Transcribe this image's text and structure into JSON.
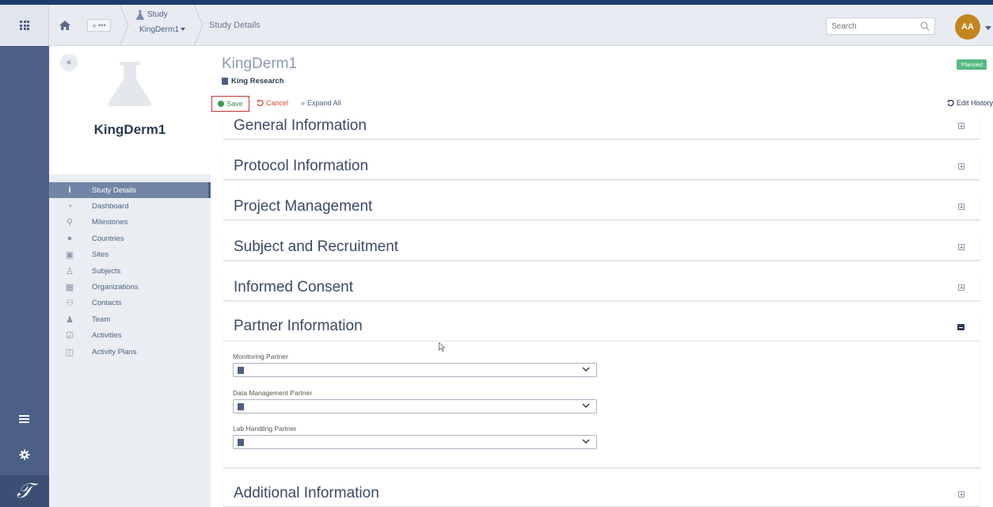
{
  "header": {
    "back_label": "« •••",
    "study_label": "Study",
    "study_value": "KingDerm1",
    "current_page": "Study Details",
    "search_placeholder": "Search",
    "avatar_initials": "AA"
  },
  "study_panel": {
    "collapse_label": "«",
    "study_name": "KingDerm1"
  },
  "nav": {
    "items": [
      {
        "label": "Study Details",
        "icon": "info-icon",
        "active": true
      },
      {
        "label": "Dashboard",
        "icon": "dashboard-icon"
      },
      {
        "label": "Milestones",
        "icon": "map-pin-icon"
      },
      {
        "label": "Countries",
        "icon": "globe-icon"
      },
      {
        "label": "Sites",
        "icon": "hospital-icon"
      },
      {
        "label": "Subjects",
        "icon": "person-icon"
      },
      {
        "label": "Organizations",
        "icon": "building-icon"
      },
      {
        "label": "Contacts",
        "icon": "people-icon"
      },
      {
        "label": "Team",
        "icon": "team-icon"
      },
      {
        "label": "Activities",
        "icon": "calendar-check-icon"
      },
      {
        "label": "Activity Plans",
        "icon": "board-icon"
      }
    ]
  },
  "main": {
    "title": "KingDerm1",
    "organization": "King Research",
    "status": "Planned",
    "toolbar": {
      "save": "Save",
      "cancel": "Cancel",
      "expand_all": "Expand All",
      "edit_history": "Edit History"
    },
    "sections": [
      {
        "title": "General Information",
        "expanded": false
      },
      {
        "title": "Protocol Information",
        "expanded": false
      },
      {
        "title": "Project Management",
        "expanded": false
      },
      {
        "title": "Subject and Recruitment",
        "expanded": false
      },
      {
        "title": "Informed Consent",
        "expanded": false
      },
      {
        "title": "Partner Information",
        "expanded": true
      },
      {
        "title": "Additional Information",
        "expanded": false
      }
    ],
    "partner_fields": [
      {
        "label": "Monitoring Partner",
        "value": ""
      },
      {
        "label": "Data Management Partner",
        "value": ""
      },
      {
        "label": "Lab Handling Partner",
        "value": ""
      }
    ]
  },
  "colors": {
    "header_border": "#1e3a6e",
    "rail": "#4b5f87",
    "avatar": "#c4851e",
    "status_badge": "#56b982",
    "save_border": "#d32f2f",
    "cancel": "#d44a3a"
  }
}
